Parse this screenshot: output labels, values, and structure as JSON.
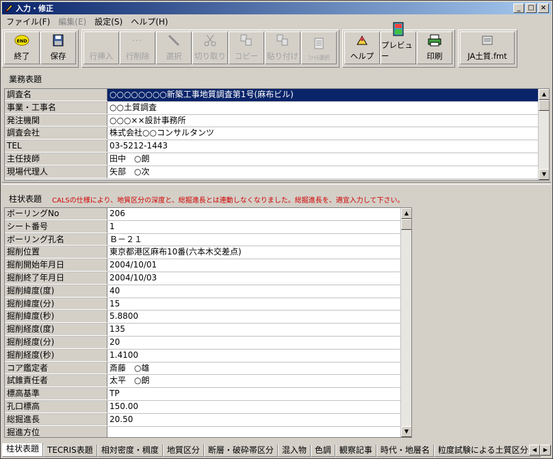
{
  "window": {
    "title": "入力・修正"
  },
  "menu": [
    {
      "label": "ファイル(F)",
      "disabled": false
    },
    {
      "label": "編集(E)",
      "disabled": true
    },
    {
      "label": "設定(S)",
      "disabled": false
    },
    {
      "label": "ヘルプ(H)",
      "disabled": false
    }
  ],
  "toolbar": {
    "end": "終了",
    "save": "保存",
    "insert_row": "行挿入",
    "delete_row": "行削除",
    "select": "選択",
    "cut": "切り取り",
    "copy": "コピー",
    "paste": "貼り付け",
    "file_select": "ﾌｧｲﾙ選択",
    "help": "ヘルプ",
    "preview": "プレビュー",
    "print": "印刷",
    "file_name": "JA土質.fmt",
    "end_icon_text": "END"
  },
  "business": {
    "label": "業務表題",
    "rows": [
      {
        "k": "調査名",
        "v": "○○○○○○○○新築工事地質調査第1号(麻布ビル)"
      },
      {
        "k": "事業・工事名",
        "v": "○○土質調査"
      },
      {
        "k": "発注機関",
        "v": "○○○××設計事務所"
      },
      {
        "k": "調査会社",
        "v": "株式会社○○コンサルタンツ"
      },
      {
        "k": "TEL",
        "v": "03-5212-1443"
      },
      {
        "k": "主任技師",
        "v": "田中　○朗"
      },
      {
        "k": "現場代理人",
        "v": "矢部　○次"
      }
    ]
  },
  "column": {
    "label": "柱状表題",
    "notice": "CALSの仕様により、地質区分の深度と、総掘進長とは連動しなくなりました。総掘進長を、適宜入力して下さい。",
    "rows": [
      {
        "k": "ボーリングNo",
        "v": "206"
      },
      {
        "k": "シート番号",
        "v": "1"
      },
      {
        "k": "ボーリング孔名",
        "v": "Ｂ－２１"
      },
      {
        "k": "掘削位置",
        "v": "東京都港区麻布10番(六本木交差点)"
      },
      {
        "k": "掘削開始年月日",
        "v": "2004/10/01"
      },
      {
        "k": "掘削終了年月日",
        "v": "2004/10/03"
      },
      {
        "k": "掘削緯度(度)",
        "v": "40"
      },
      {
        "k": "掘削緯度(分)",
        "v": "15"
      },
      {
        "k": "掘削緯度(秒)",
        "v": " 5.8800"
      },
      {
        "k": "掘削経度(度)",
        "v": "135"
      },
      {
        "k": "掘削経度(分)",
        "v": "20"
      },
      {
        "k": "掘削経度(秒)",
        "v": " 1.4100"
      },
      {
        "k": "コア鑑定者",
        "v": "斎藤　○雄"
      },
      {
        "k": "試錐責任者",
        "v": "太平　○朗"
      },
      {
        "k": "標高基準",
        "v": "TP"
      },
      {
        "k": "孔口標高",
        "v": " 150.00"
      },
      {
        "k": "総掘進長",
        "v": "  20.50"
      },
      {
        "k": "掘進方位",
        "v": ""
      }
    ]
  },
  "tabs": [
    "柱状表題",
    "TECRIS表題",
    "相対密度・稠度",
    "地質区分",
    "断層・破砕帯区分",
    "混入物",
    "色調",
    "観察記事",
    "時代・地層名",
    "粒度試験による土質区分名"
  ],
  "tab_active": 0
}
